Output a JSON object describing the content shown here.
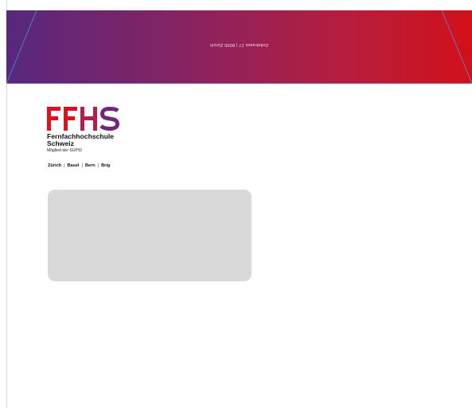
{
  "flap": {
    "address_line": "Zollstrasse 17 | 8005 Zürich",
    "colors": {
      "left": "#57287d",
      "right": "#d2101a",
      "lines": "#4a90e2"
    }
  },
  "logo": {
    "mark": "FFHS",
    "name_line1": "Fernfachhochschule",
    "name_line2": "Schweiz",
    "tagline": "Mitglied der SUPSI",
    "colors": {
      "F1": "#e0101e",
      "F2": "#e0101e",
      "H": "#b51d4c",
      "S": "#72267a"
    }
  },
  "locations": [
    "Zürich",
    "Basel",
    "Bern",
    "Brig"
  ],
  "address_window": {
    "color": "#d9d9d9"
  }
}
